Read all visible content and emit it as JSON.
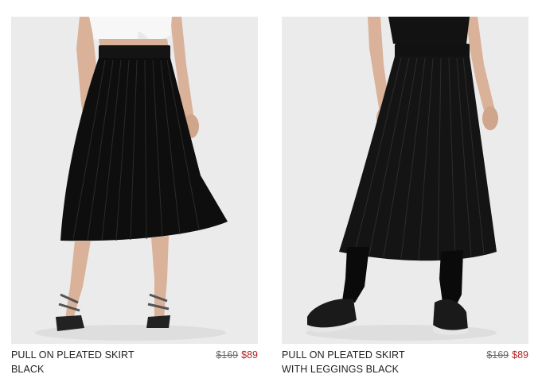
{
  "products": [
    {
      "name_line1": "PULL ON PLEATED SKIRT",
      "name_line2": "BLACK",
      "original_price": "$169",
      "sale_price": "$89",
      "image_alt": "Pull on pleated skirt, black"
    },
    {
      "name_line1": "PULL ON PLEATED SKIRT",
      "name_line2": "WITH LEGGINGS BLACK",
      "original_price": "$169",
      "sale_price": "$89",
      "image_alt": "Pull on pleated skirt with leggings, black"
    }
  ],
  "colors": {
    "photo_background": "#ebebeb",
    "sale_price": "#b32424",
    "original_price": "#6b6b6b",
    "product_name": "#222222"
  }
}
